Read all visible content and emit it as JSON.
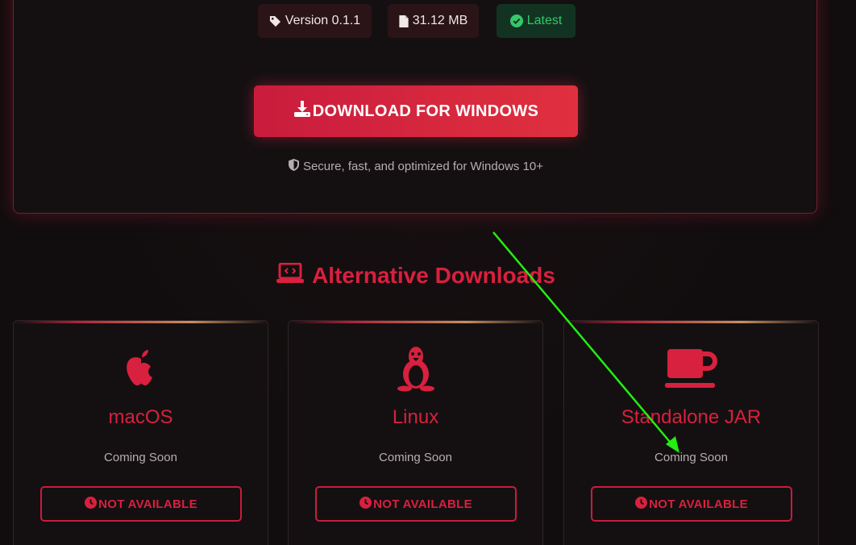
{
  "hero": {
    "badges": {
      "version": "Version 0.1.1",
      "size": "31.12 MB",
      "status": "Latest"
    },
    "download_label": "DOWNLOAD FOR WINDOWS",
    "secure_text": "Secure, fast, and optimized for Windows 10+"
  },
  "alternative": {
    "heading": "Alternative Downloads",
    "cards": [
      {
        "icon": "apple-icon",
        "title": "macOS",
        "status": "Coming Soon",
        "button": "NOT AVAILABLE"
      },
      {
        "icon": "linux-tux-icon",
        "title": "Linux",
        "status": "Coming Soon",
        "button": "NOT AVAILABLE"
      },
      {
        "icon": "coffee-cup-icon",
        "title": "Standalone JAR",
        "status": "Coming Soon",
        "button": "NOT AVAILABLE"
      }
    ]
  },
  "colors": {
    "accent": "#d8203f",
    "background": "#110d0e",
    "success": "#35c76a",
    "annotation_arrow": "#22ee11"
  }
}
